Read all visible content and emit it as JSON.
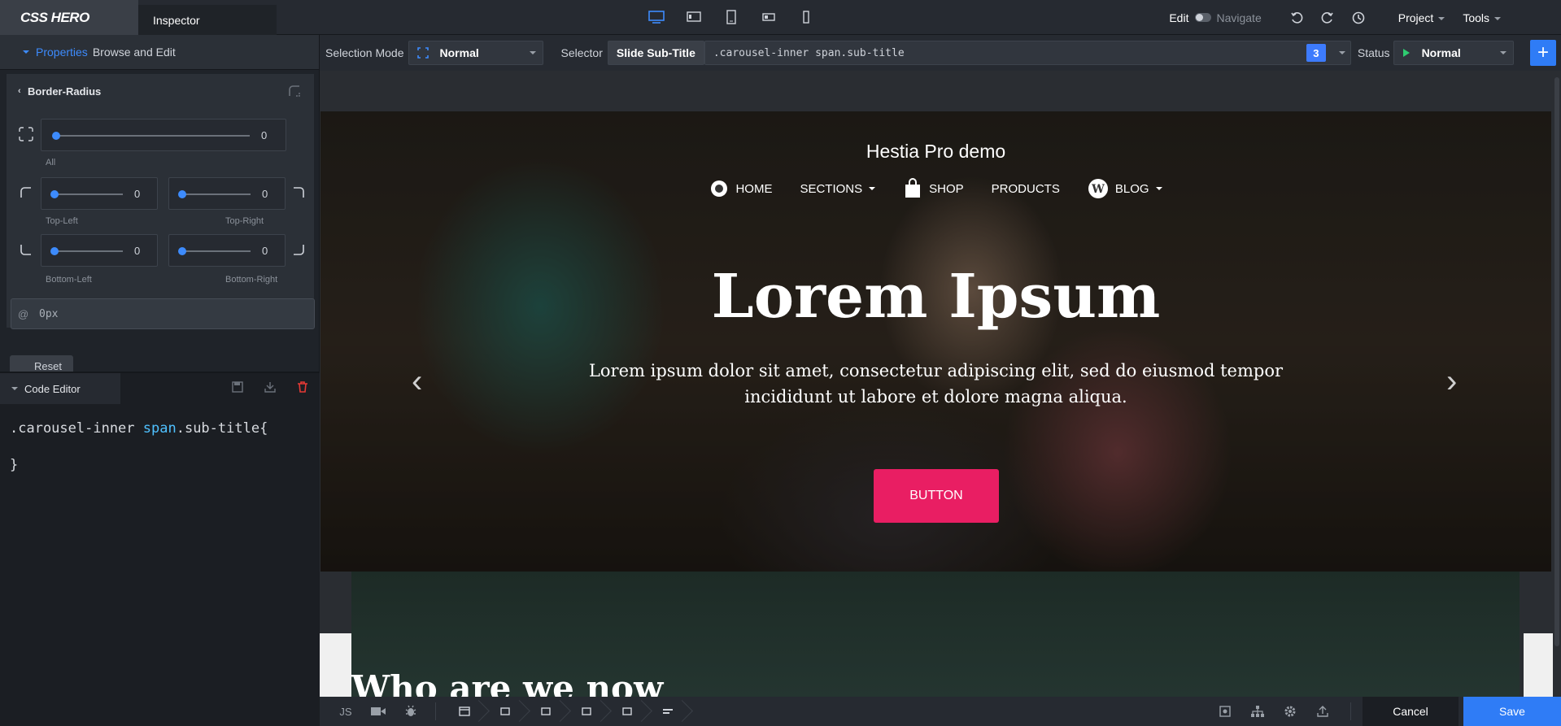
{
  "app": {
    "logo": "CSS HERO",
    "inspector_tab": "Inspector"
  },
  "topbar": {
    "devices": [
      "desktop-icon",
      "laptop-icon",
      "tablet-icon",
      "tablet-landscape-icon",
      "mobile-icon"
    ],
    "edit_label": "Edit",
    "navigate_label": "Navigate",
    "project_label": "Project",
    "tools_label": "Tools"
  },
  "properties": {
    "title": "Properties",
    "subtitle": "Browse and Edit"
  },
  "border_radius": {
    "heading": "Border-Radius",
    "all": {
      "label": "All",
      "value": "0"
    },
    "top_left": {
      "label": "Top-Left",
      "value": "0"
    },
    "top_right": {
      "label": "Top-Right",
      "value": "0"
    },
    "bottom_left": {
      "label": "Bottom-Left",
      "value": "0"
    },
    "bottom_right": {
      "label": "Bottom-Right",
      "value": "0"
    },
    "input_value": "0px",
    "input_prefix": "@",
    "reset_label": "Reset"
  },
  "code_editor": {
    "title": "Code Editor",
    "line1_a": ".carousel-inner ",
    "line1_b": "span",
    "line1_c": ".sub-title{",
    "line2": "}"
  },
  "toolbar": {
    "selection_mode_label": "Selection Mode",
    "selection_mode_value": "Normal",
    "selector_label": "Selector",
    "selector_name": "Slide Sub-Title",
    "selector_path": ".carousel-inner span.sub-title",
    "match_count": "3",
    "status_label": "Status",
    "status_value": "Normal",
    "add_label": "+"
  },
  "site": {
    "title": "Hestia Pro demo",
    "nav": [
      "HOME",
      "SECTIONS",
      "SHOP",
      "PRODUCTS",
      "BLOG"
    ],
    "heading": "Lorem Ipsum",
    "subtitle": "Lorem ipsum dolor sit amet, consectetur adipiscing elit, sed do eiusmod tempor incididunt ut labore et dolore magna aliqua.",
    "button": "BUTTON",
    "section_heading": "Who are we now"
  },
  "bottombar": {
    "js_label": "JS",
    "cancel": "Cancel",
    "save": "Save"
  },
  "colors": {
    "accent": "#2f7cf6",
    "brand_button": "#e91e63",
    "delete": "#e53935"
  }
}
